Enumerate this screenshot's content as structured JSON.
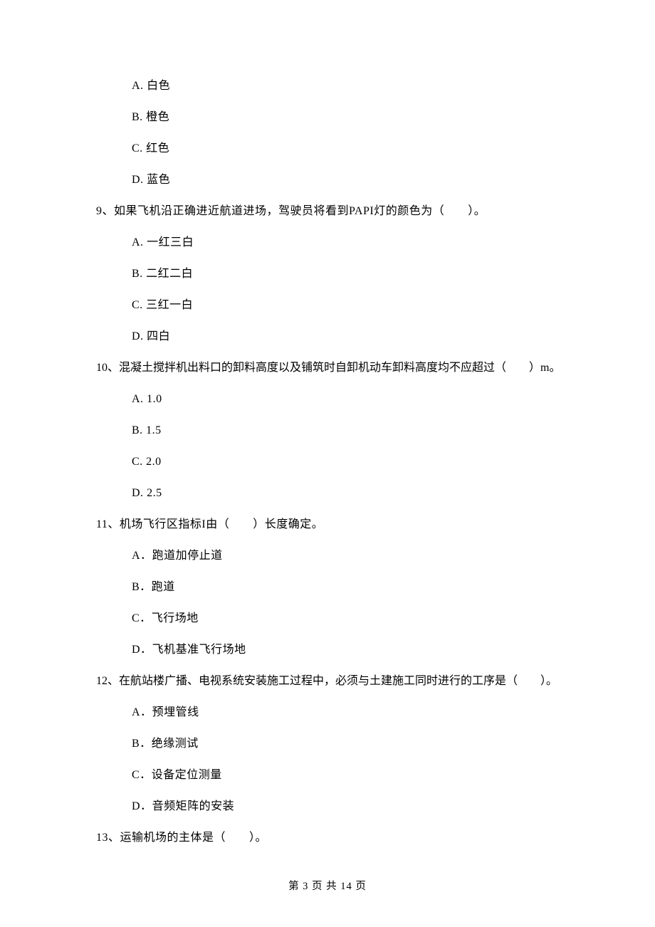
{
  "preOptions": [
    {
      "label": "A.",
      "text": "白色"
    },
    {
      "label": "B.",
      "text": "橙色"
    },
    {
      "label": "C.",
      "text": "红色"
    },
    {
      "label": "D.",
      "text": "蓝色"
    }
  ],
  "q9": {
    "stem": "9、如果飞机沿正确进近航道进场，驾驶员将看到PAPI灯的颜色为（　　）。",
    "options": [
      {
        "label": "A.",
        "text": "一红三白"
      },
      {
        "label": "B.",
        "text": "二红二白"
      },
      {
        "label": "C.",
        "text": "三红一白"
      },
      {
        "label": "D.",
        "text": "四白"
      }
    ]
  },
  "q10": {
    "stem": "10、混凝土搅拌机出料口的卸料高度以及铺筑时自卸机动车卸料高度均不应超过（　　）m。",
    "options": [
      {
        "label": "A.",
        "text": "1.0"
      },
      {
        "label": "B.",
        "text": "1.5"
      },
      {
        "label": "C.",
        "text": "2.0"
      },
      {
        "label": "D.",
        "text": "2.5"
      }
    ]
  },
  "q11": {
    "stem": "11、机场飞行区指标I由（　　）长度确定。",
    "options": [
      {
        "label": "A．",
        "text": "跑道加停止道"
      },
      {
        "label": "B．",
        "text": "跑道"
      },
      {
        "label": "C．",
        "text": "飞行场地"
      },
      {
        "label": "D．",
        "text": "飞机基准飞行场地"
      }
    ]
  },
  "q12": {
    "stem": "12、在航站楼广播、电视系统安装施工过程中，必须与土建施工同时进行的工序是（　　）。",
    "options": [
      {
        "label": "A．",
        "text": "预埋管线"
      },
      {
        "label": "B．",
        "text": "绝缘测试"
      },
      {
        "label": "C．",
        "text": "设备定位测量"
      },
      {
        "label": "D．",
        "text": "音频矩阵的安装"
      }
    ]
  },
  "q13": {
    "stem": "13、运输机场的主体是（　　）。"
  },
  "footer": "第 3 页 共 14 页"
}
